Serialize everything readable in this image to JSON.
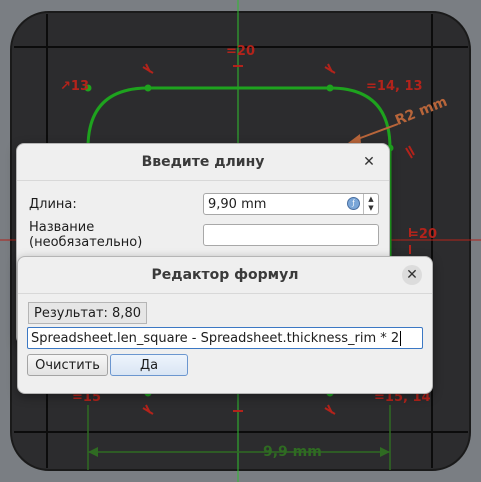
{
  "sketch": {
    "constraints": {
      "top_center": "20",
      "top_left": "13",
      "top_right": "14, 13",
      "right_mid": "20",
      "bottom_left": "15",
      "bottom_right": "15, 14"
    },
    "radius_label": "R2 mm",
    "width_dimension": "9,9 mm",
    "colors": {
      "outline": "#1ea31e",
      "constraint": "#b3231b",
      "dimension": "#2f6b22",
      "axis": "#2fbf2f"
    }
  },
  "length_dialog": {
    "title": "Введите длину",
    "length_label": "Длина:",
    "length_value": "9,90 mm",
    "name_label": "Название (необязательно)",
    "name_value": ""
  },
  "formula_dialog": {
    "title": "Редактор формул",
    "result": "Результат: 8,80",
    "formula": "Spreadsheet.len_square - Spreadsheet.thickness_rim * 2",
    "clear_label": "Очистить",
    "ok_label": "Да"
  }
}
